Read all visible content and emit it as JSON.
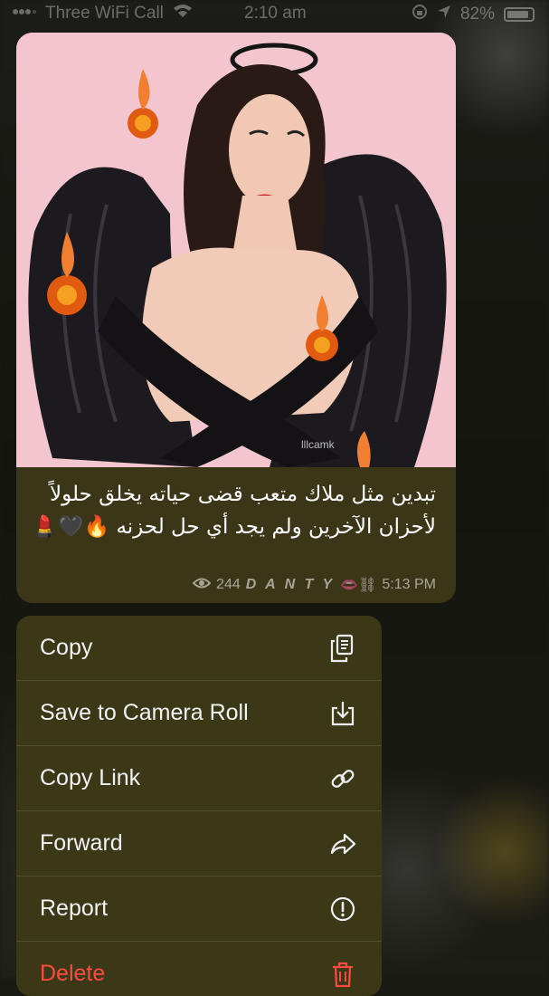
{
  "status_bar": {
    "carrier": "Three WiFi Call",
    "time": "2:10 am",
    "battery": "82%"
  },
  "message": {
    "image_watermark": "lllcamk",
    "caption": "تبدين مثل ملاك متعب قضى حياته يخلق حلولاً لأحزان الآخرين ولم يجد أي حل لحزنه 🔥🖤💄",
    "views": "244",
    "signature": "D A N T Y",
    "signature_emoji": "👄⛓",
    "time": "5:13 PM"
  },
  "context_menu": {
    "items": [
      {
        "label": "Copy",
        "icon": "copy-icon"
      },
      {
        "label": "Save to Camera Roll",
        "icon": "save-download-icon"
      },
      {
        "label": "Copy Link",
        "icon": "link-icon"
      },
      {
        "label": "Forward",
        "icon": "forward-icon"
      },
      {
        "label": "Report",
        "icon": "report-exclamation-icon"
      },
      {
        "label": "Delete",
        "icon": "trash-icon"
      }
    ],
    "delete_color": "#ff4a3f"
  }
}
